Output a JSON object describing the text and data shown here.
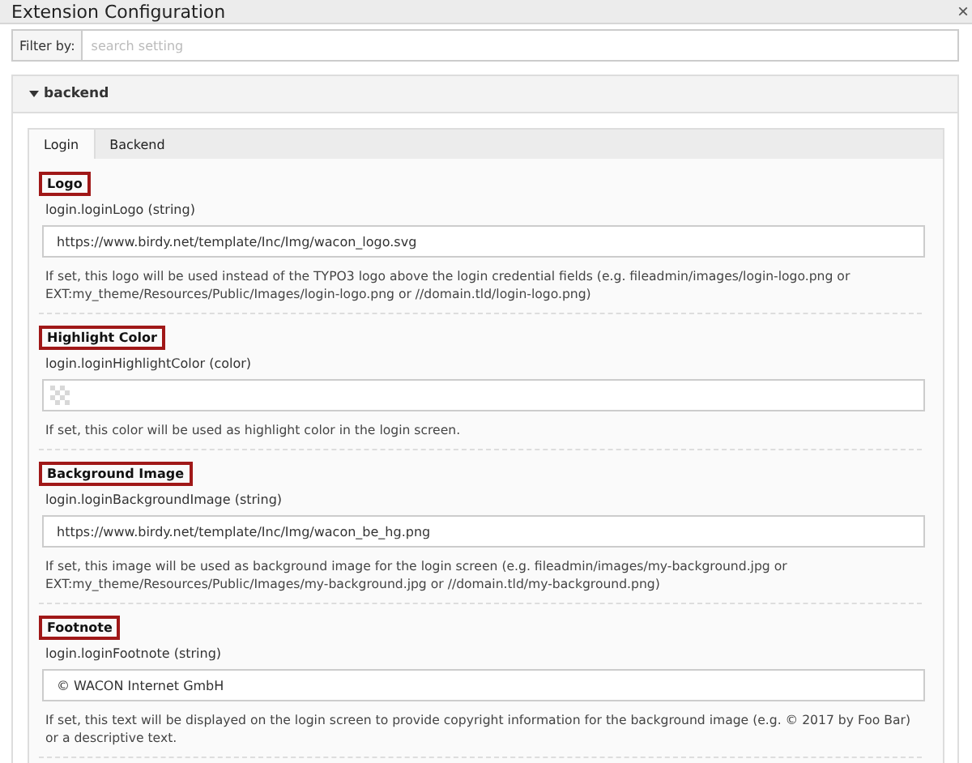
{
  "window": {
    "title": "Extension Configuration",
    "close": "×"
  },
  "filter": {
    "label": "Filter by:",
    "placeholder": "search setting"
  },
  "section": {
    "title": "backend",
    "expanded": true
  },
  "tabs": [
    {
      "label": "Login",
      "selected": true
    },
    {
      "label": "Backend",
      "selected": false
    }
  ],
  "fields": [
    {
      "kind": "text",
      "label": "Logo",
      "key": "login.loginLogo (string)",
      "value": "https://www.birdy.net/template/Inc/Img/wacon_logo.svg",
      "description": "If set, this logo will be used instead of the TYPO3 logo above the login credential fields (e.g. fileadmin/images/login-logo.png or EXT:my_theme/Resources/Public/Images/login-logo.png or //domain.tld/login-logo.png)"
    },
    {
      "kind": "color",
      "label": "Highlight Color",
      "key": "login.loginHighlightColor (color)",
      "description": "If set, this color will be used as highlight color in the login screen."
    },
    {
      "kind": "text",
      "label": "Background Image",
      "key": "login.loginBackgroundImage (string)",
      "value": "https://www.birdy.net/template/Inc/Img/wacon_be_hg.png",
      "description": "If set, this image will be used as background image for the login screen (e.g. fileadmin/images/my-background.jpg or EXT:my_theme/Resources/Public/Images/my-background.jpg or //domain.tld/my-background.png)"
    },
    {
      "kind": "text",
      "label": "Footnote",
      "key": "login.loginFootnote (string)",
      "value": "© WACON Internet GmbH",
      "description": "If set, this text will be displayed on the login screen to provide copyright information for the background image (e.g. © 2017 by Foo Bar) or a descriptive text."
    }
  ]
}
